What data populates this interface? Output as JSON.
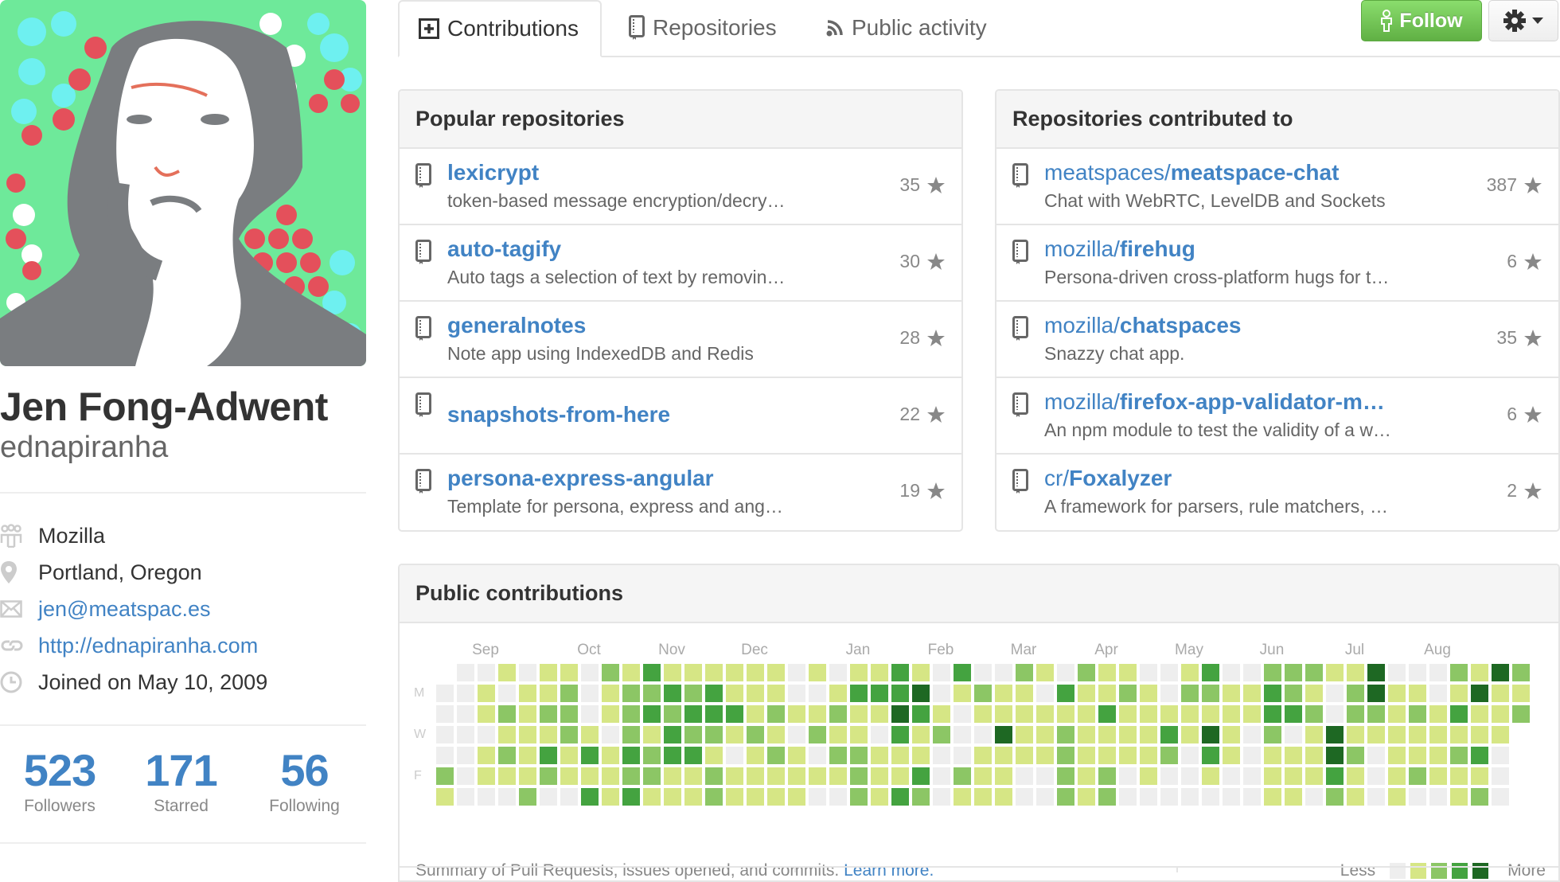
{
  "profile": {
    "full_name": "Jen Fong-Adwent",
    "username": "ednapiranha",
    "avatar_alt": "avatar",
    "details": [
      {
        "icon": "organization-icon",
        "text": "Mozilla",
        "link": false
      },
      {
        "icon": "location-icon",
        "text": "Portland, Oregon",
        "link": false
      },
      {
        "icon": "mail-icon",
        "text": "jen@meatspac.es",
        "link": true
      },
      {
        "icon": "link-icon",
        "text": "http://ednapiranha.com",
        "link": true
      },
      {
        "icon": "clock-icon",
        "text": "Joined on May 10, 2009",
        "link": false
      }
    ],
    "stats": [
      {
        "value": "523",
        "label": "Followers"
      },
      {
        "value": "171",
        "label": "Starred"
      },
      {
        "value": "56",
        "label": "Following"
      }
    ]
  },
  "tabs": [
    {
      "label": "Contributions",
      "icon": "contributions-icon",
      "active": true
    },
    {
      "label": "Repositories",
      "icon": "repo-icon",
      "active": false
    },
    {
      "label": "Public activity",
      "icon": "rss-icon",
      "active": false
    }
  ],
  "actions": {
    "follow_label": "Follow",
    "settings_icon": "gear-icon"
  },
  "popular_repos": {
    "title": "Popular repositories",
    "items": [
      {
        "name": "lexicrypt",
        "description": "token-based message encryption/decry…",
        "stars": "35"
      },
      {
        "name": "auto-tagify",
        "description": "Auto tags a selection of text by removin…",
        "stars": "30"
      },
      {
        "name": "generalnotes",
        "description": "Note app using IndexedDB and Redis",
        "stars": "28"
      },
      {
        "name": "snapshots-from-here",
        "description": "",
        "stars": "22"
      },
      {
        "name": "persona-express-angular",
        "description": "Template for persona, express and ang…",
        "stars": "19"
      }
    ]
  },
  "contributed_repos": {
    "title": "Repositories contributed to",
    "items": [
      {
        "owner": "meatspaces/",
        "name": "meatspace-chat",
        "description": "Chat with WebRTC, LevelDB and Sockets",
        "stars": "387"
      },
      {
        "owner": "mozilla/",
        "name": "firehug",
        "description": "Persona-driven cross-platform hugs for t…",
        "stars": "6"
      },
      {
        "owner": "mozilla/",
        "name": "chatspaces",
        "description": "Snazzy chat app.",
        "stars": "35"
      },
      {
        "owner": "mozilla/",
        "name": "firefox-app-validator-m…",
        "description": "An npm module to test the validity of a w…",
        "stars": "6"
      },
      {
        "owner": "cr/",
        "name": "Foxalyzer",
        "description": "A framework for parsers, rule matchers, …",
        "stars": "2"
      }
    ]
  },
  "contributions": {
    "title": "Public contributions",
    "summary": "Summary of Pull Requests, issues opened, and commits.",
    "learn_more": "Learn more.",
    "legend_less": "Less",
    "legend_more": "More",
    "colors": [
      "#eeeeee",
      "#d6e685",
      "#8cc665",
      "#44a340",
      "#1e6823"
    ],
    "day_labels": [
      {
        "row": 1,
        "label": "M"
      },
      {
        "row": 3,
        "label": "W"
      },
      {
        "row": 5,
        "label": "F"
      }
    ],
    "months": [
      {
        "label": "Sep",
        "week": 2
      },
      {
        "label": "Oct",
        "week": 7
      },
      {
        "label": "Nov",
        "week": 11
      },
      {
        "label": "Dec",
        "week": 15
      },
      {
        "label": "Jan",
        "week": 20
      },
      {
        "label": "Feb",
        "week": 24
      },
      {
        "label": "Mar",
        "week": 28
      },
      {
        "label": "Apr",
        "week": 32
      },
      {
        "label": "May",
        "week": 36
      },
      {
        "label": "Jun",
        "week": 40
      },
      {
        "label": "Jul",
        "week": 44
      },
      {
        "label": "Aug",
        "week": 48
      }
    ],
    "weeks_levels": [
      [
        null,
        0,
        0,
        0,
        0,
        2,
        1
      ],
      [
        0,
        0,
        0,
        0,
        0,
        0,
        0
      ],
      [
        0,
        1,
        1,
        0,
        1,
        1,
        0
      ],
      [
        1,
        0,
        2,
        1,
        2,
        1,
        0
      ],
      [
        0,
        1,
        1,
        1,
        1,
        1,
        2
      ],
      [
        1,
        1,
        2,
        1,
        3,
        2,
        0
      ],
      [
        1,
        2,
        2,
        2,
        1,
        1,
        0
      ],
      [
        0,
        0,
        0,
        1,
        3,
        1,
        3
      ],
      [
        2,
        1,
        1,
        0,
        1,
        1,
        1
      ],
      [
        1,
        2,
        2,
        2,
        3,
        2,
        3
      ],
      [
        3,
        2,
        3,
        1,
        2,
        2,
        1
      ],
      [
        1,
        3,
        2,
        3,
        3,
        1,
        1
      ],
      [
        1,
        2,
        3,
        2,
        3,
        1,
        1
      ],
      [
        1,
        3,
        3,
        2,
        1,
        2,
        2
      ],
      [
        1,
        1,
        3,
        1,
        0,
        1,
        1
      ],
      [
        1,
        1,
        1,
        2,
        1,
        1,
        1
      ],
      [
        1,
        1,
        2,
        1,
        2,
        1,
        1
      ],
      [
        0,
        0,
        1,
        0,
        1,
        1,
        1
      ],
      [
        1,
        0,
        1,
        2,
        0,
        1,
        0
      ],
      [
        0,
        1,
        2,
        1,
        2,
        1,
        0
      ],
      [
        1,
        3,
        1,
        1,
        2,
        2,
        2
      ],
      [
        1,
        3,
        1,
        0,
        1,
        1,
        1
      ],
      [
        3,
        3,
        4,
        3,
        1,
        1,
        3
      ],
      [
        1,
        4,
        3,
        1,
        1,
        3,
        2
      ],
      [
        0,
        0,
        1,
        2,
        0,
        0,
        0
      ],
      [
        3,
        1,
        0,
        0,
        0,
        2,
        1
      ],
      [
        0,
        2,
        1,
        0,
        1,
        1,
        1
      ],
      [
        0,
        1,
        1,
        4,
        1,
        1,
        1
      ],
      [
        2,
        1,
        1,
        1,
        1,
        0,
        0
      ],
      [
        1,
        0,
        1,
        1,
        1,
        0,
        0
      ],
      [
        0,
        3,
        1,
        2,
        2,
        2,
        2
      ],
      [
        2,
        1,
        1,
        1,
        1,
        1,
        1
      ],
      [
        1,
        1,
        3,
        1,
        1,
        2,
        2
      ],
      [
        1,
        2,
        1,
        1,
        1,
        0,
        0
      ],
      [
        0,
        1,
        1,
        1,
        1,
        1,
        0
      ],
      [
        0,
        0,
        1,
        3,
        2,
        0,
        0
      ],
      [
        1,
        2,
        1,
        1,
        0,
        0,
        0
      ],
      [
        3,
        2,
        1,
        4,
        3,
        1,
        0
      ],
      [
        0,
        1,
        1,
        1,
        1,
        0,
        0
      ],
      [
        0,
        1,
        1,
        0,
        0,
        0,
        0
      ],
      [
        2,
        3,
        3,
        2,
        1,
        1,
        1
      ],
      [
        2,
        2,
        3,
        0,
        1,
        1,
        1
      ],
      [
        2,
        1,
        2,
        1,
        1,
        1,
        0
      ],
      [
        1,
        0,
        0,
        4,
        4,
        3,
        2
      ],
      [
        1,
        2,
        2,
        1,
        2,
        1,
        1
      ],
      [
        4,
        4,
        2,
        1,
        0,
        0,
        0
      ],
      [
        0,
        1,
        1,
        1,
        1,
        1,
        1
      ],
      [
        0,
        1,
        2,
        1,
        1,
        2,
        0
      ],
      [
        0,
        0,
        1,
        1,
        1,
        1,
        0
      ],
      [
        2,
        1,
        3,
        1,
        2,
        1,
        1
      ],
      [
        1,
        4,
        1,
        1,
        3,
        1,
        2
      ],
      [
        4,
        1,
        1,
        1,
        0,
        0,
        0
      ],
      [
        2,
        1,
        2,
        null,
        null,
        null,
        null
      ]
    ]
  },
  "chart_data": {
    "type": "heatmap",
    "title": "Public contributions",
    "xlabel": "",
    "ylabel": "",
    "x_tick_labels": [
      "Sep",
      "Oct",
      "Nov",
      "Dec",
      "Jan",
      "Feb",
      "Mar",
      "Apr",
      "May",
      "Jun",
      "Jul",
      "Aug"
    ],
    "y_tick_labels": [
      "M",
      "W",
      "F"
    ],
    "levels_scale": [
      "none",
      "low",
      "medium",
      "high",
      "highest"
    ],
    "note": "values are intensity levels 0-4 per day, weeks as columns (Sun..Sat rows); see contributions.weeks_levels"
  }
}
